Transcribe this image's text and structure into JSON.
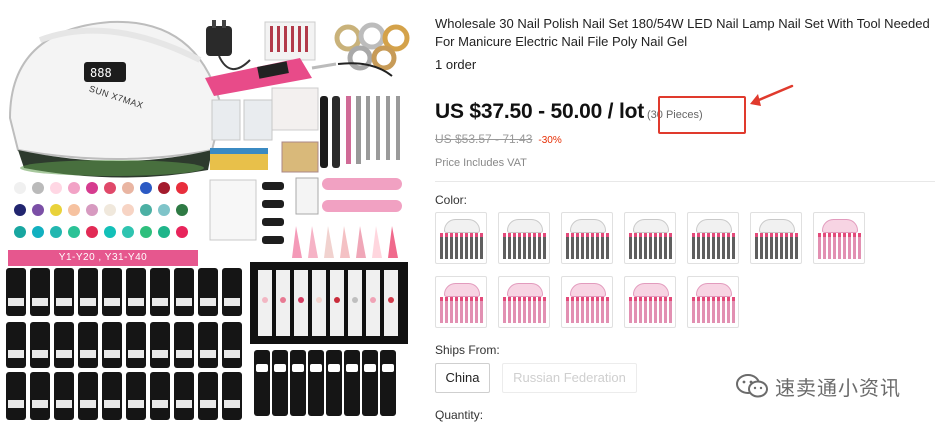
{
  "product": {
    "title": "Wholesale 30 Nail Polish Nail Set 180/54W LED Nail Lamp Nail Set With Tool Needed For Manicure Electric Nail File Poly Nail Gel",
    "orders": "1 order",
    "price": "US $37.50 - 50.00 / lot",
    "pieces": "(30 Pieces)",
    "original_price": "US $53.57 - 71.43",
    "discount": "-30%",
    "vat_note": "Price Includes VAT"
  },
  "image": {
    "lamp_brand": "SUN X7MAX",
    "color_label": "Y1-Y20 , Y31-Y40"
  },
  "color": {
    "label": "Color:",
    "swatches": [
      {
        "style": "white"
      },
      {
        "style": "white"
      },
      {
        "style": "white"
      },
      {
        "style": "white"
      },
      {
        "style": "white"
      },
      {
        "style": "white"
      },
      {
        "style": "pink"
      },
      {
        "style": "pink"
      },
      {
        "style": "pink"
      },
      {
        "style": "pink"
      },
      {
        "style": "pink"
      },
      {
        "style": "pink"
      }
    ]
  },
  "shipping": {
    "label": "Ships From:",
    "options": [
      "China",
      "Russian Federation"
    ]
  },
  "quantity": {
    "label": "Quantity:"
  },
  "watermark": {
    "text": "速卖通小资讯"
  },
  "colors": {
    "highlight": "#e03a2d",
    "discount": "#e62e04",
    "brand_pink": "#e6578e"
  }
}
